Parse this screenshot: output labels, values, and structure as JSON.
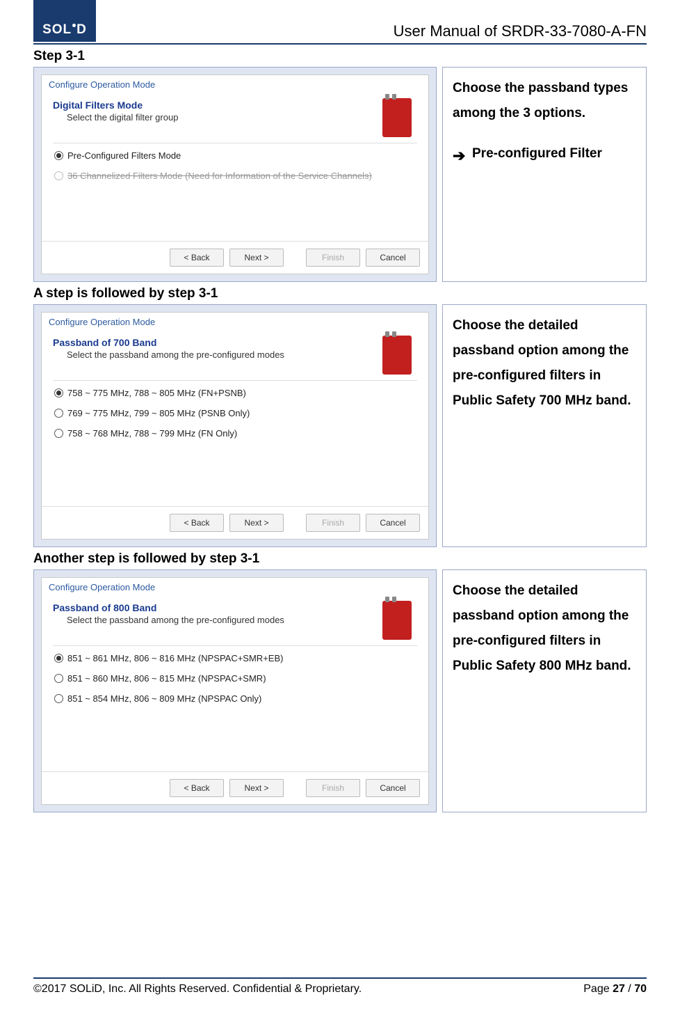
{
  "header": {
    "logo_text": "SOLiD",
    "doc_title": "User Manual of SRDR-33-7080-A-FN"
  },
  "sections": [
    {
      "heading": "Step 3-1",
      "dialog": {
        "title": "Configure Operation Mode",
        "heading": "Digital Filters Mode",
        "sub": "Select the digital filter group",
        "options": [
          {
            "label": "Pre-Configured Filters Mode",
            "selected": true,
            "disabled": false
          },
          {
            "label": "36 Channelized Filters Mode (Need for Information of the Service Channels)",
            "selected": false,
            "disabled": true
          }
        ],
        "buttons": {
          "back": "< Back",
          "next": "Next >",
          "finish": "Finish",
          "cancel": "Cancel"
        }
      },
      "desc": {
        "line1": "Choose the passband types among the 3 options.",
        "arrow_item": "Pre-configured Filter"
      }
    },
    {
      "heading": "A step is followed by step 3-1",
      "dialog": {
        "title": "Configure Operation Mode",
        "heading": "Passband of 700 Band",
        "sub": "Select the passband among the pre-configured modes",
        "options": [
          {
            "label": "758 ~ 775 MHz, 788 ~ 805 MHz (FN+PSNB)",
            "selected": true,
            "disabled": false
          },
          {
            "label": "769 ~ 775 MHz, 799 ~ 805 MHz (PSNB Only)",
            "selected": false,
            "disabled": false
          },
          {
            "label": "758 ~ 768 MHz, 788 ~ 799 MHz (FN Only)",
            "selected": false,
            "disabled": false
          }
        ],
        "buttons": {
          "back": "< Back",
          "next": "Next >",
          "finish": "Finish",
          "cancel": "Cancel"
        }
      },
      "desc": {
        "line1": "Choose the detailed passband option among the pre-configured filters in Public Safety 700 MHz band."
      }
    },
    {
      "heading": "Another step is followed by step 3-1",
      "dialog": {
        "title": "Configure Operation Mode",
        "heading": "Passband of 800 Band",
        "sub": "Select the passband among the pre-configured modes",
        "options": [
          {
            "label": "851 ~ 861 MHz, 806 ~ 816 MHz (NPSPAC+SMR+EB)",
            "selected": true,
            "disabled": false
          },
          {
            "label": "851 ~ 860 MHz, 806 ~ 815 MHz (NPSPAC+SMR)",
            "selected": false,
            "disabled": false
          },
          {
            "label": "851 ~ 854 MHz, 806 ~ 809 MHz (NPSPAC Only)",
            "selected": false,
            "disabled": false
          }
        ],
        "buttons": {
          "back": "< Back",
          "next": "Next >",
          "finish": "Finish",
          "cancel": "Cancel"
        }
      },
      "desc": {
        "line1": "Choose the detailed passband option among the pre-configured filters in Public Safety 800 MHz band."
      }
    }
  ],
  "footer": {
    "copyright": "©2017 SOLiD, Inc. All Rights Reserved. Confidential & Proprietary.",
    "page_label": "Page ",
    "page_current": "27",
    "page_sep": " / ",
    "page_total": "70"
  }
}
